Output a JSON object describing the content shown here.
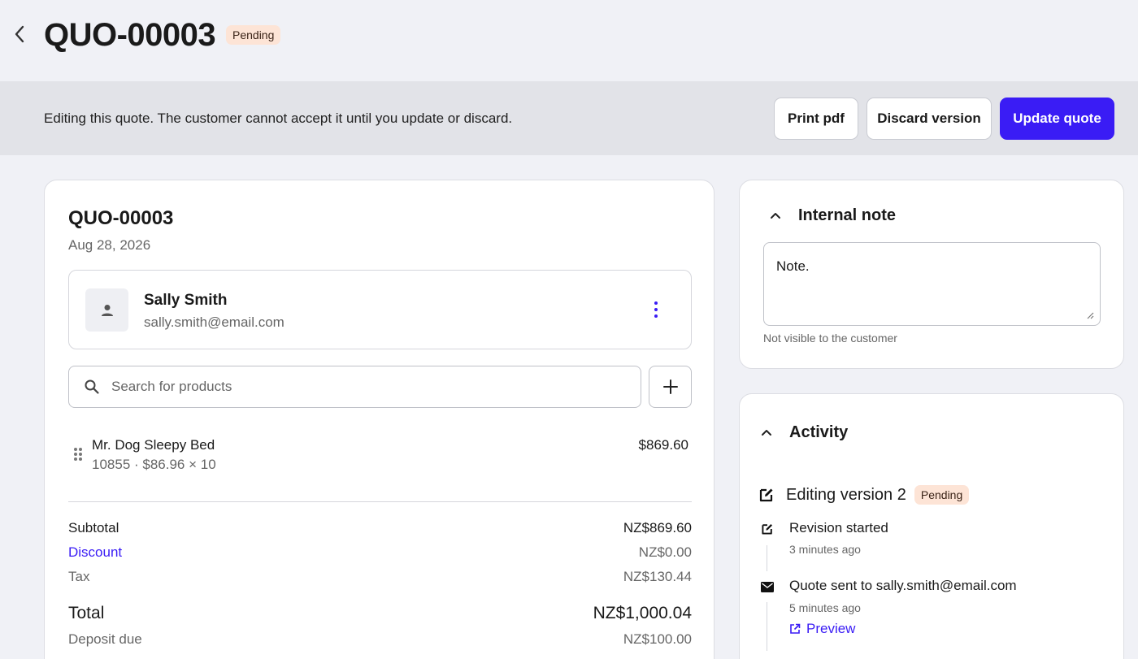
{
  "header": {
    "back_icon": "chevron-left-icon",
    "title": "QUO-00003",
    "status": "Pending"
  },
  "banner": {
    "message": "Editing this quote. The customer cannot accept it until you update or discard.",
    "print_label": "Print pdf",
    "discard_label": "Discard version",
    "update_label": "Update quote"
  },
  "quote": {
    "number": "QUO-00003",
    "date": "Aug 28, 2026",
    "customer": {
      "name": "Sally Smith",
      "email": "sally.smith@email.com",
      "avatar_icon": "person-icon",
      "menu_icon": "kebab-menu-icon"
    },
    "search": {
      "placeholder": "Search for products",
      "value": ""
    },
    "line_items": [
      {
        "name": "Mr. Dog Sleepy Bed",
        "meta": "10855 · $86.96 × 10",
        "price": "$869.60"
      }
    ],
    "summary": {
      "subtotal_label": "Subtotal",
      "subtotal": "NZ$869.60",
      "discount_label": "Discount",
      "discount": "NZ$0.00",
      "tax_label": "Tax",
      "tax": "NZ$130.44",
      "total_label": "Total",
      "total": "NZ$1,000.04",
      "deposit_label": "Deposit due",
      "deposit": "NZ$100.00"
    }
  },
  "internal_note": {
    "title": "Internal note",
    "value": "Note.",
    "hint": "Not visible to the customer"
  },
  "activity": {
    "title": "Activity",
    "version_title": "Editing version 2",
    "version_status": "Pending",
    "events": [
      {
        "icon": "edit-icon",
        "text": "Revision started",
        "time": "3 minutes ago"
      },
      {
        "icon": "mail-icon",
        "text": "Quote sent to sally.smith@email.com",
        "time": "5 minutes ago",
        "link": "Preview"
      }
    ]
  },
  "colors": {
    "accent": "#3a1cf5",
    "background": "#f0f1f6",
    "banner": "#e2e3e8",
    "pending_badge": "#fde4d6"
  }
}
